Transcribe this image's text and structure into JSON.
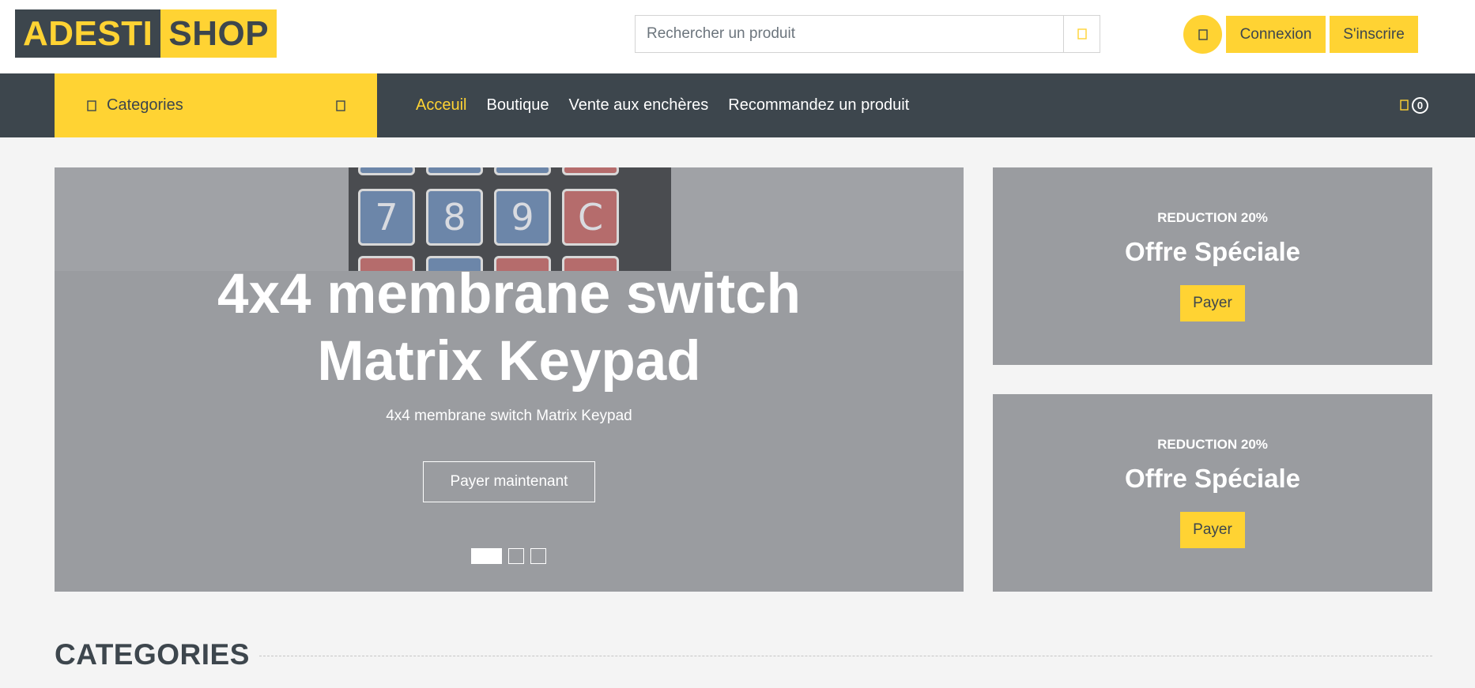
{
  "brand": {
    "left": "ADESTI",
    "right": "SHOP"
  },
  "search": {
    "placeholder": "Rechercher un produit",
    "icon": "search-icon"
  },
  "header": {
    "user_icon": "user-icon",
    "login_label": "Connexion",
    "register_label": "S'inscrire"
  },
  "nav": {
    "categories_label": "Categories",
    "links": [
      {
        "label": "Acceuil",
        "active": true
      },
      {
        "label": "Boutique"
      },
      {
        "label": "Vente aux enchères"
      },
      {
        "label": "Recommandez un produit"
      }
    ],
    "cart_count": "0"
  },
  "carousel": {
    "title_line1": "4x4 membrane switch",
    "title_line2": "Matrix Keypad",
    "subtitle": "4x4 membrane switch Matrix Keypad",
    "button_label": "Payer maintenant",
    "keys": [
      "7",
      "8",
      "9",
      "C"
    ],
    "slide_count": 3,
    "active_slide": 1
  },
  "offers": [
    {
      "reduction": "REDUCTION 20%",
      "title": "Offre Spéciale",
      "button": "Payer"
    },
    {
      "reduction": "REDUCTION 20%",
      "title": "Offre Spéciale",
      "button": "Payer"
    }
  ],
  "sections": {
    "categories_title": "CATEGORIES"
  },
  "colors": {
    "accent": "#ffd333",
    "dark": "#3d464d",
    "background": "#f4f4f4"
  }
}
